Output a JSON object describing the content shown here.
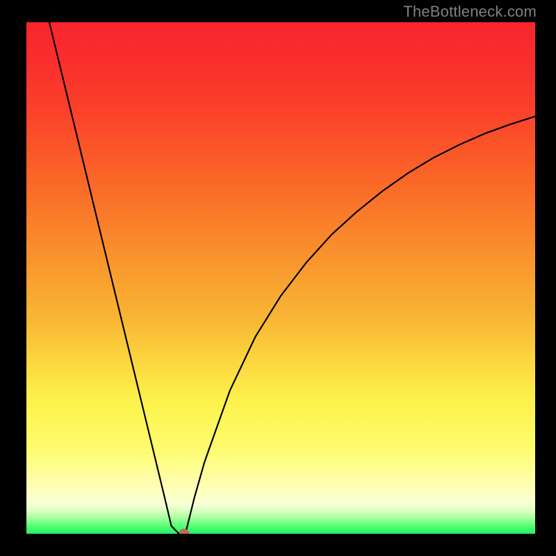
{
  "watermark_text": "TheBottleneck.com",
  "colors": {
    "frame_bg": "#000000",
    "watermark": "#808080",
    "curve_stroke": "#000000",
    "marker_fill": "#c36a5a",
    "gradient_top": "#f9252c",
    "gradient_bottom": "#22f062"
  },
  "chart_data": {
    "type": "line",
    "title": "",
    "xlabel": "",
    "ylabel": "",
    "xlim": [
      0,
      100
    ],
    "ylim": [
      0,
      100
    ],
    "grid": false,
    "legend": false,
    "series": [
      {
        "name": "bottleneck-curve",
        "x": [
          4.5,
          10,
          15,
          20,
          25,
          27,
          28.5,
          30,
          31,
          31.5,
          33,
          35,
          40,
          45,
          50,
          55,
          60,
          65,
          70,
          75,
          80,
          85,
          90,
          95,
          100
        ],
        "values": [
          100,
          77.5,
          57.0,
          36.5,
          16.0,
          7.8,
          1.5,
          0.0,
          0.0,
          1.0,
          7.0,
          14.0,
          28.0,
          38.5,
          46.5,
          53.0,
          58.5,
          63.0,
          67.0,
          70.5,
          73.5,
          76.0,
          78.2,
          80.0,
          81.6
        ]
      }
    ],
    "marker": {
      "x": 31,
      "y": 0.3
    },
    "background_gradient": {
      "orientation": "vertical",
      "stops": [
        {
          "pos": 0.0,
          "color": "#f9252c"
        },
        {
          "pos": 0.08,
          "color": "#fa2f2c"
        },
        {
          "pos": 0.18,
          "color": "#fb432a"
        },
        {
          "pos": 0.32,
          "color": "#fa6a28"
        },
        {
          "pos": 0.46,
          "color": "#f9932c"
        },
        {
          "pos": 0.58,
          "color": "#f9b634"
        },
        {
          "pos": 0.66,
          "color": "#fbd53e"
        },
        {
          "pos": 0.74,
          "color": "#fdf24b"
        },
        {
          "pos": 0.835,
          "color": "#fefc6e"
        },
        {
          "pos": 0.89,
          "color": "#feffa4"
        },
        {
          "pos": 0.92,
          "color": "#fdffc1"
        },
        {
          "pos": 0.943,
          "color": "#f6ffd6"
        },
        {
          "pos": 0.957,
          "color": "#d6ffbd"
        },
        {
          "pos": 0.97,
          "color": "#a1ff9c"
        },
        {
          "pos": 0.984,
          "color": "#5aff74"
        },
        {
          "pos": 1.0,
          "color": "#22f062"
        }
      ]
    }
  }
}
